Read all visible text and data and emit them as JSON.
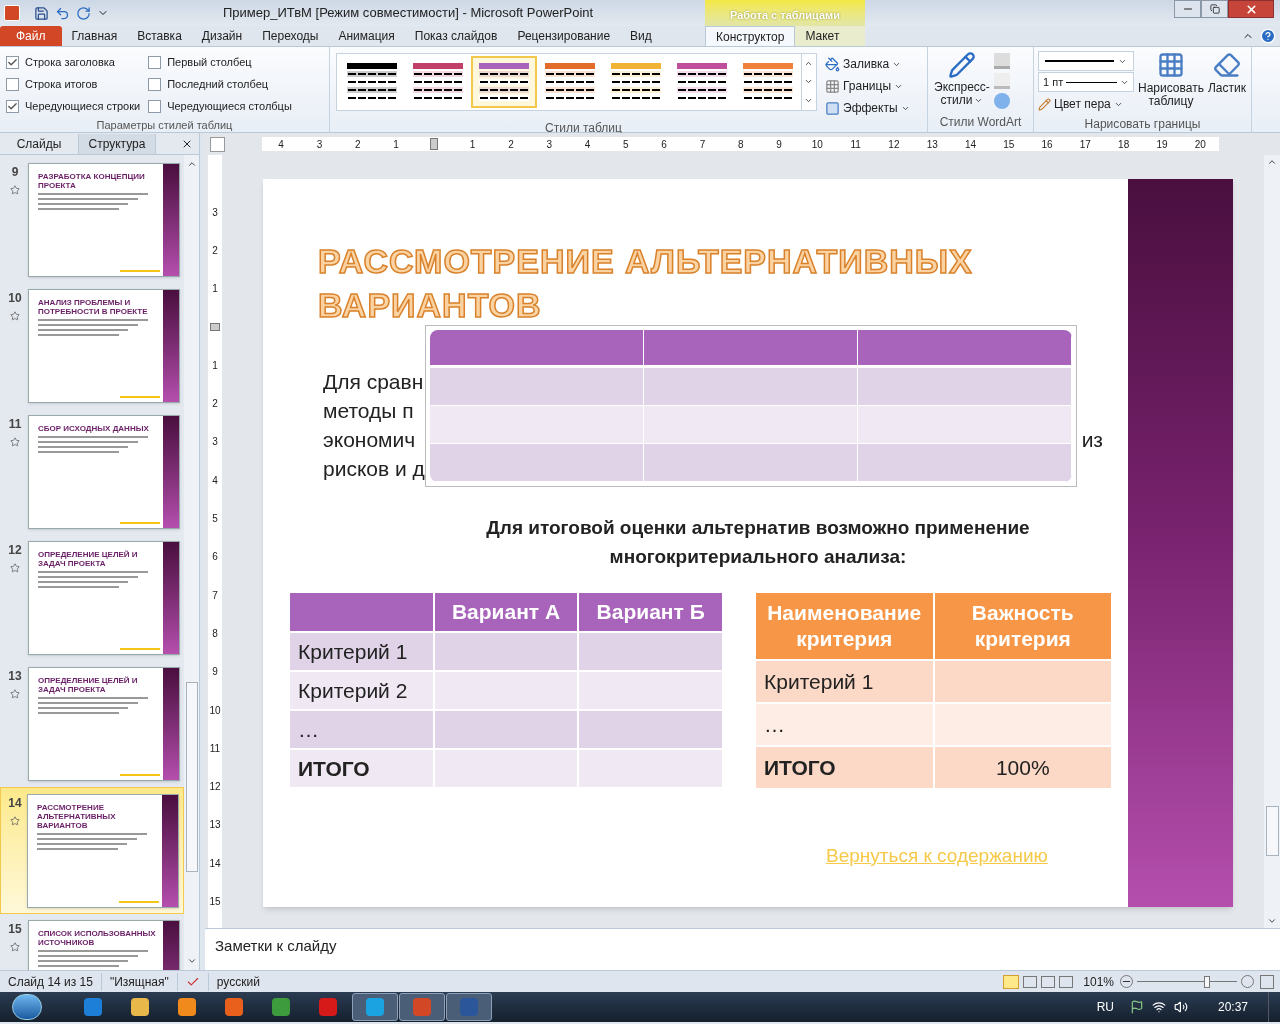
{
  "window": {
    "title": "Пример_ИТвМ [Режим совместимости]  -  Microsoft PowerPoint",
    "context_group": "Работа с таблицами"
  },
  "ribbon_tabs": [
    {
      "label": "Файл",
      "kind": "file",
      "selected": false
    },
    {
      "label": "Главная",
      "kind": "normal",
      "selected": false
    },
    {
      "label": "Вставка",
      "kind": "normal",
      "selected": false
    },
    {
      "label": "Дизайн",
      "kind": "normal",
      "selected": false
    },
    {
      "label": "Переходы",
      "kind": "normal",
      "selected": false
    },
    {
      "label": "Анимация",
      "kind": "normal",
      "selected": false
    },
    {
      "label": "Показ слайдов",
      "kind": "normal",
      "selected": false
    },
    {
      "label": "Рецензирование",
      "kind": "normal",
      "selected": false
    },
    {
      "label": "Вид",
      "kind": "normal",
      "selected": false
    },
    {
      "label": "Конструктор",
      "kind": "context",
      "selected": true
    },
    {
      "label": "Макет",
      "kind": "context",
      "selected": false
    }
  ],
  "style_options": {
    "title": "Параметры стилей таблиц",
    "items": [
      {
        "label": "Строка заголовка",
        "checked": true
      },
      {
        "label": "Строка итогов",
        "checked": false
      },
      {
        "label": "Чередующиеся строки",
        "checked": true
      },
      {
        "label": "Первый столбец",
        "checked": false
      },
      {
        "label": "Последний столбец",
        "checked": false
      },
      {
        "label": "Чередующиеся столбцы",
        "checked": false
      }
    ]
  },
  "table_styles": {
    "title": "Стили таблиц",
    "swatches": [
      {
        "color": "#000000",
        "selected": false
      },
      {
        "color": "#c0406a",
        "selected": false
      },
      {
        "color": "#a864bb",
        "selected": true
      },
      {
        "color": "#e36c2a",
        "selected": false
      },
      {
        "color": "#f2b233",
        "selected": false
      },
      {
        "color": "#c1509c",
        "selected": false
      },
      {
        "color": "#f0803a",
        "selected": false
      }
    ],
    "buttons": [
      {
        "label": "Заливка",
        "kind": "fill"
      },
      {
        "label": "Границы",
        "kind": "borders"
      },
      {
        "label": "Эффекты",
        "kind": "effects"
      }
    ]
  },
  "wordart": {
    "title": "Стили WordArt",
    "quick_styles": [
      "Экспресс-",
      "стили"
    ]
  },
  "draw_borders": {
    "title": "Нарисовать границы",
    "pen_weight": "1 пт",
    "pen_color": "Цвет пера",
    "draw_table": [
      "Нарисовать",
      "таблицу"
    ],
    "eraser": "Ластик"
  },
  "slides_panel": {
    "tabs": [
      {
        "label": "Слайды",
        "selected": true
      },
      {
        "label": "Структура",
        "selected": false
      }
    ],
    "thumbnails": [
      {
        "number": "9",
        "title": "РАЗРАБОТКА КОНЦЕПЦИИ ПРОЕКТА",
        "selected": false
      },
      {
        "number": "10",
        "title": "АНАЛИЗ ПРОБЛЕМЫ И ПОТРЕБНОСТИ В ПРОЕКТЕ",
        "selected": false
      },
      {
        "number": "11",
        "title": "СБОР ИСХОДНЫХ ДАННЫХ",
        "selected": false
      },
      {
        "number": "12",
        "title": "ОПРЕДЕЛЕНИЕ ЦЕЛЕЙ И ЗАДАЧ ПРОЕКТА",
        "selected": false
      },
      {
        "number": "13",
        "title": "ОПРЕДЕЛЕНИЕ ЦЕЛЕЙ И ЗАДАЧ ПРОЕКТА",
        "selected": false
      },
      {
        "number": "14",
        "title": "РАССМОТРЕНИЕ АЛЬТЕРНАТИВНЫХ ВАРИАНТОВ",
        "selected": true
      },
      {
        "number": "15",
        "title": "СПИСОК ИСПОЛЬЗОВАННЫХ ИСТОЧНИКОВ",
        "selected": false
      }
    ]
  },
  "ruler": {
    "horizontal": [
      {
        "kind": "number",
        "label": "4"
      },
      {
        "kind": "number",
        "label": "3"
      },
      {
        "kind": "number",
        "label": "2"
      },
      {
        "kind": "number",
        "label": "1"
      },
      {
        "kind": "marker"
      },
      {
        "kind": "number",
        "label": "1"
      },
      {
        "kind": "number",
        "label": "2"
      },
      {
        "kind": "number",
        "label": "3"
      },
      {
        "kind": "number",
        "label": "4"
      },
      {
        "kind": "number",
        "label": "5"
      },
      {
        "kind": "number",
        "label": "6"
      },
      {
        "kind": "number",
        "label": "7"
      },
      {
        "kind": "number",
        "label": "8"
      },
      {
        "kind": "number",
        "label": "9"
      },
      {
        "kind": "number",
        "label": "10"
      },
      {
        "kind": "number",
        "label": "11"
      },
      {
        "kind": "number",
        "label": "12"
      },
      {
        "kind": "number",
        "label": "13"
      },
      {
        "kind": "number",
        "label": "14"
      },
      {
        "kind": "number",
        "label": "15"
      },
      {
        "kind": "number",
        "label": "16"
      },
      {
        "kind": "number",
        "label": "17"
      },
      {
        "kind": "number",
        "label": "18"
      },
      {
        "kind": "number",
        "label": "19"
      },
      {
        "kind": "number",
        "label": "20"
      }
    ],
    "vertical": [
      {
        "kind": "number",
        "label": "3"
      },
      {
        "kind": "number",
        "label": "2"
      },
      {
        "kind": "number",
        "label": "1"
      },
      {
        "kind": "marker"
      },
      {
        "kind": "number",
        "label": "1"
      },
      {
        "kind": "number",
        "label": "2"
      },
      {
        "kind": "number",
        "label": "3"
      },
      {
        "kind": "number",
        "label": "4"
      },
      {
        "kind": "number",
        "label": "5"
      },
      {
        "kind": "number",
        "label": "6"
      },
      {
        "kind": "number",
        "label": "7"
      },
      {
        "kind": "number",
        "label": "8"
      },
      {
        "kind": "number",
        "label": "9"
      },
      {
        "kind": "number",
        "label": "10"
      },
      {
        "kind": "number",
        "label": "11"
      },
      {
        "kind": "number",
        "label": "12"
      },
      {
        "kind": "number",
        "label": "13"
      },
      {
        "kind": "number",
        "label": "14"
      },
      {
        "kind": "number",
        "label": "15"
      }
    ]
  },
  "slide": {
    "title": "РАССМОТРЕНИЕ  АЛЬТЕРНАТИВНЫХ ВАРИАНТОВ",
    "body_lines": [
      {
        "left": "Для сравн"
      },
      {
        "left": "методы п"
      },
      {
        "left": "экономич",
        "right": "из"
      },
      {
        "left": "рисков и д"
      }
    ],
    "subtitle": "Для итоговой оценки альтернатив возможно применение многокритериального анализа:",
    "variants_table": {
      "columns": [
        "",
        "Вариант А",
        "Вариант Б"
      ],
      "rows": [
        [
          "Критерий 1",
          "",
          ""
        ],
        [
          "Критерий 2",
          "",
          ""
        ],
        [
          "…",
          "",
          ""
        ],
        [
          "ИТОГО",
          "",
          ""
        ]
      ]
    },
    "weights_table": {
      "columns": [
        "Наименование критерия",
        "Важность критерия"
      ],
      "rows": [
        [
          "Критерий 1",
          ""
        ],
        [
          "…",
          ""
        ],
        [
          "ИТОГО",
          "100%"
        ]
      ]
    },
    "link": "Вернуться к содержанию"
  },
  "notes": {
    "placeholder": "Заметки к слайду"
  },
  "status_bar": {
    "slide": "Слайд 14 из 15",
    "theme": "\"Изящная\"",
    "language": "русский",
    "zoom": "101%",
    "zoom_slider": {
      "level": 0.7
    }
  },
  "taskbar": {
    "apps": [
      {
        "color": "#1e7fd8",
        "running": false
      },
      {
        "color": "#e8b84a",
        "running": false
      },
      {
        "color": "#f08a1c",
        "running": false
      },
      {
        "color": "#e8601c",
        "running": false
      },
      {
        "color": "#3d9b3d",
        "running": false
      },
      {
        "color": "#d61a1a",
        "running": false
      },
      {
        "color": "#1aa3e0",
        "running": true
      },
      {
        "color": "#d24726",
        "running": true
      },
      {
        "color": "#2b579a",
        "running": true
      }
    ],
    "language": "RU",
    "time": "20:37"
  }
}
